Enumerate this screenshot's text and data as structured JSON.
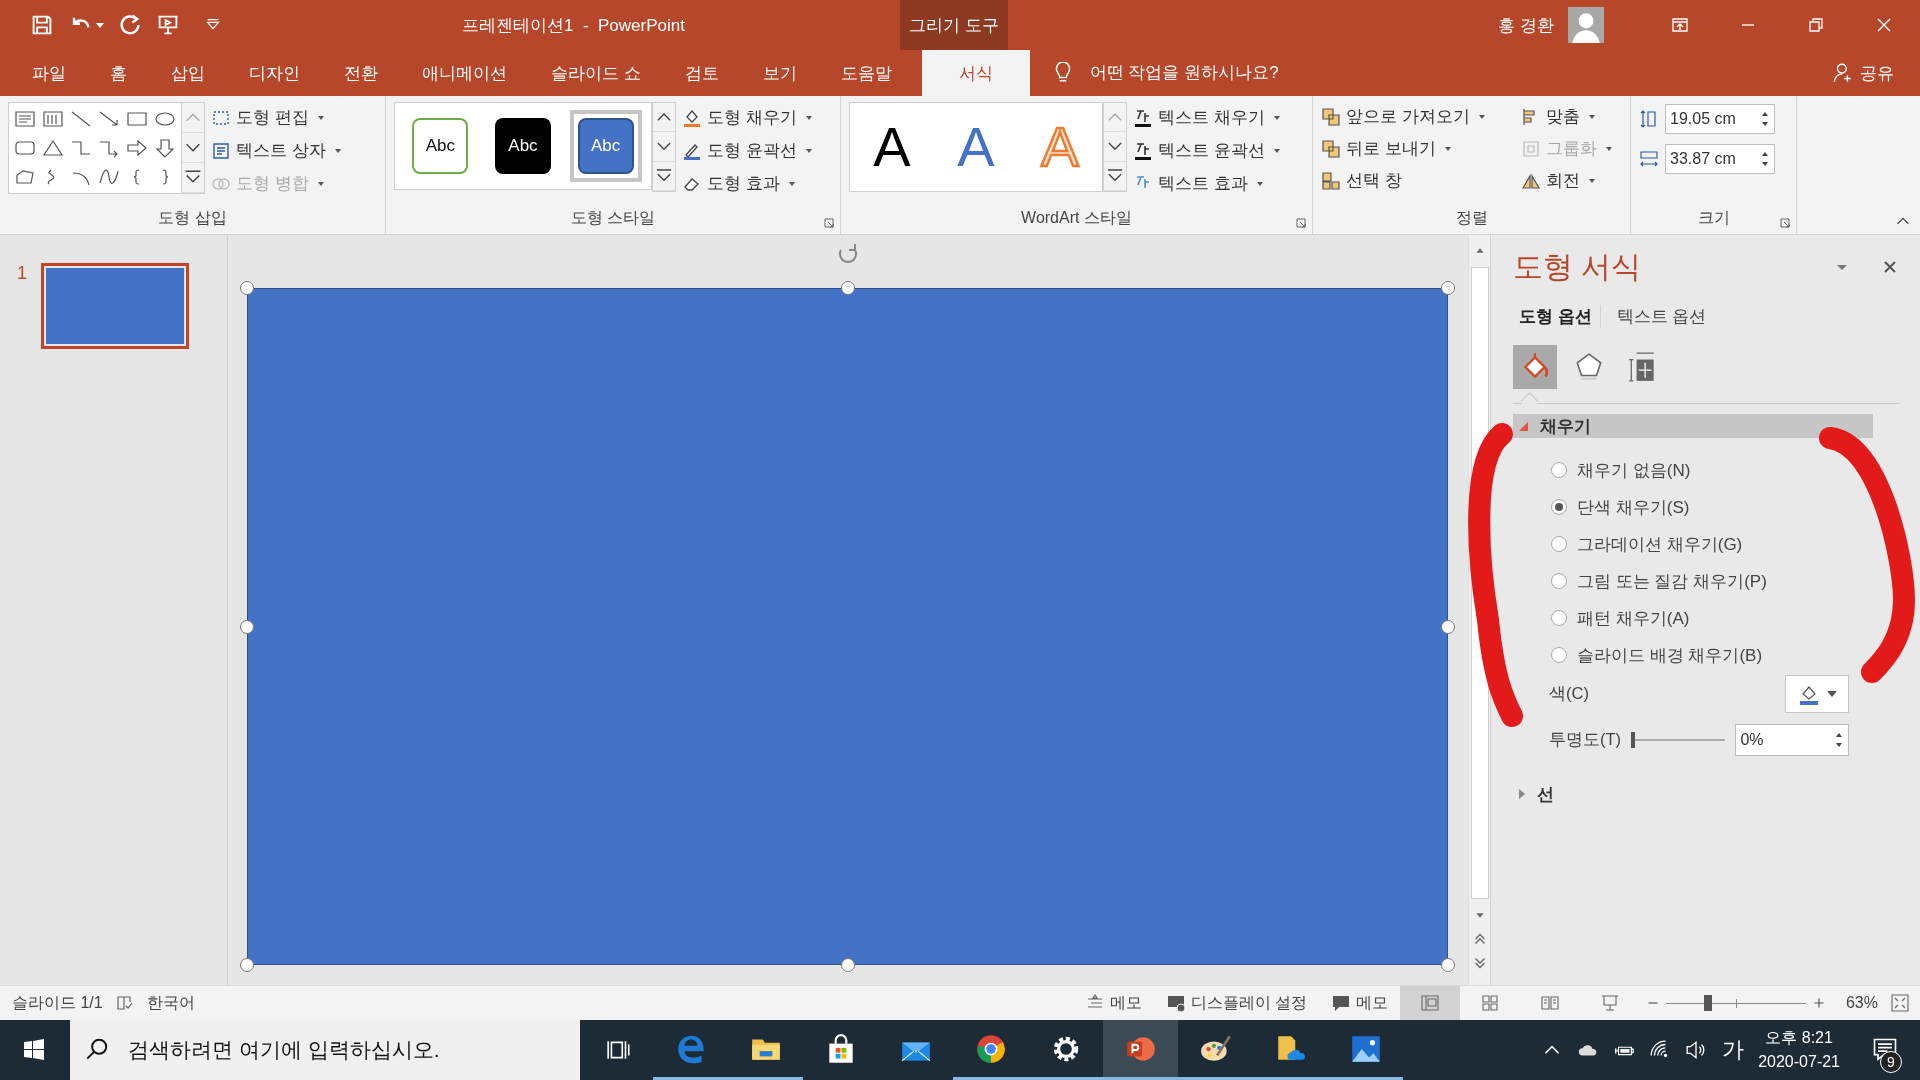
{
  "title_bar": {
    "title": "프레젠테이션1  -  PowerPoint",
    "context_tab": "그리기 도구",
    "user": "홍 경환"
  },
  "tabs": [
    {
      "label": "파일",
      "selected": false
    },
    {
      "label": "홈",
      "selected": false
    },
    {
      "label": "삽입",
      "selected": false
    },
    {
      "label": "디자인",
      "selected": false
    },
    {
      "label": "전환",
      "selected": false
    },
    {
      "label": "애니메이션",
      "selected": false
    },
    {
      "label": "슬라이드 쇼",
      "selected": false
    },
    {
      "label": "검토",
      "selected": false
    },
    {
      "label": "보기",
      "selected": false
    },
    {
      "label": "도움말",
      "selected": false
    },
    {
      "label": "서식",
      "selected": true
    }
  ],
  "tell_me": {
    "placeholder": "어떤 작업을 원하시나요?"
  },
  "share": "공유",
  "insert_shapes": {
    "label": "도형 삽입",
    "commands": [
      {
        "label": "도형 편집",
        "disabled": false
      },
      {
        "label": "텍스트 상자",
        "disabled": false
      },
      {
        "label": "도형 병합",
        "disabled": true
      }
    ]
  },
  "shape_styles": {
    "label": "도형 스타일",
    "presets": [
      {
        "text": "Abc",
        "kind": "outline",
        "selected": false
      },
      {
        "text": "Abc",
        "kind": "dark",
        "selected": false
      },
      {
        "text": "Abc",
        "kind": "blue",
        "selected": true
      }
    ],
    "commands": [
      {
        "label": "도형 채우기"
      },
      {
        "label": "도형 윤곽선"
      },
      {
        "label": "도형 효과"
      }
    ]
  },
  "wordart": {
    "label": "WordArt 스타일",
    "presets": [
      {
        "text": "A",
        "kind": "plain"
      },
      {
        "text": "A",
        "kind": "blue"
      },
      {
        "text": "A",
        "kind": "orange"
      }
    ],
    "commands": [
      {
        "label": "텍스트 채우기"
      },
      {
        "label": "텍스트 윤곽선"
      },
      {
        "label": "텍스트 효과"
      }
    ]
  },
  "arrange": {
    "label": "정렬",
    "commands": [
      {
        "label": "앞으로 가져오기",
        "disabled": false
      },
      {
        "label": "뒤로 보내기",
        "disabled": false
      },
      {
        "label": "선택 창",
        "disabled": false
      },
      {
        "label": "맞춤",
        "disabled": false
      },
      {
        "label": "그룹화",
        "disabled": true
      },
      {
        "label": "회전",
        "disabled": false
      }
    ]
  },
  "size": {
    "label": "크기",
    "height": "19.05 cm",
    "width": "33.87 cm"
  },
  "thumbnails": [
    {
      "number": "1",
      "selected": true
    }
  ],
  "format_pane": {
    "title": "도형 서식",
    "tabs": [
      {
        "label": "도형 옵션",
        "selected": true
      },
      {
        "label": "텍스트 옵션",
        "selected": false
      }
    ],
    "icon_tabs": [
      {
        "kind": "fill",
        "selected": true
      },
      {
        "kind": "effects",
        "selected": false
      },
      {
        "kind": "layout",
        "selected": false
      }
    ],
    "fill_section": {
      "title": "채우기",
      "expanded": true,
      "options": [
        {
          "label": "채우기 없음(N)",
          "selected": false
        },
        {
          "label": "단색 채우기(S)",
          "selected": true
        },
        {
          "label": "그라데이션 채우기(G)",
          "selected": false
        },
        {
          "label": "그림 또는 질감 채우기(P)",
          "selected": false
        },
        {
          "label": "패턴 채우기(A)",
          "selected": false
        },
        {
          "label": "슬라이드 배경 채우기(B)",
          "selected": false
        }
      ],
      "color_label": "색(C)",
      "transparency_label": "투명도(T)",
      "transparency": "0%",
      "level": 0
    },
    "line_section": {
      "title": "선",
      "expanded": false
    }
  },
  "status_bar": {
    "slide": "슬라이드 1/1",
    "language": "한국어",
    "notes": "메모",
    "display": "디스플레이 설정",
    "comments": "메모",
    "views": [
      {
        "kind": "normal",
        "selected": true
      },
      {
        "kind": "sorter",
        "selected": false
      },
      {
        "kind": "reading",
        "selected": false
      },
      {
        "kind": "slideshow",
        "selected": false
      }
    ],
    "zoom": "63%",
    "level": 0.3
  },
  "taskbar": {
    "search": {
      "placeholder": "검색하려면 여기에 입력하십시오."
    },
    "apps": [
      {
        "kind": "edge",
        "running": true,
        "selected": false
      },
      {
        "kind": "explorer",
        "running": true,
        "selected": false
      },
      {
        "kind": "store",
        "running": false,
        "selected": false
      },
      {
        "kind": "mail",
        "running": false,
        "selected": false
      },
      {
        "kind": "chrome",
        "running": true,
        "selected": false
      },
      {
        "kind": "settings",
        "running": true,
        "selected": false
      },
      {
        "kind": "powerpoint",
        "running": true,
        "selected": true
      },
      {
        "kind": "paint",
        "running": true,
        "selected": false
      },
      {
        "kind": "onedrive",
        "running": true,
        "selected": false
      },
      {
        "kind": "photos",
        "running": true,
        "selected": false
      }
    ],
    "ime": "가",
    "time": "오후 8:21",
    "date": "2020-07-21",
    "notifications": "9"
  }
}
